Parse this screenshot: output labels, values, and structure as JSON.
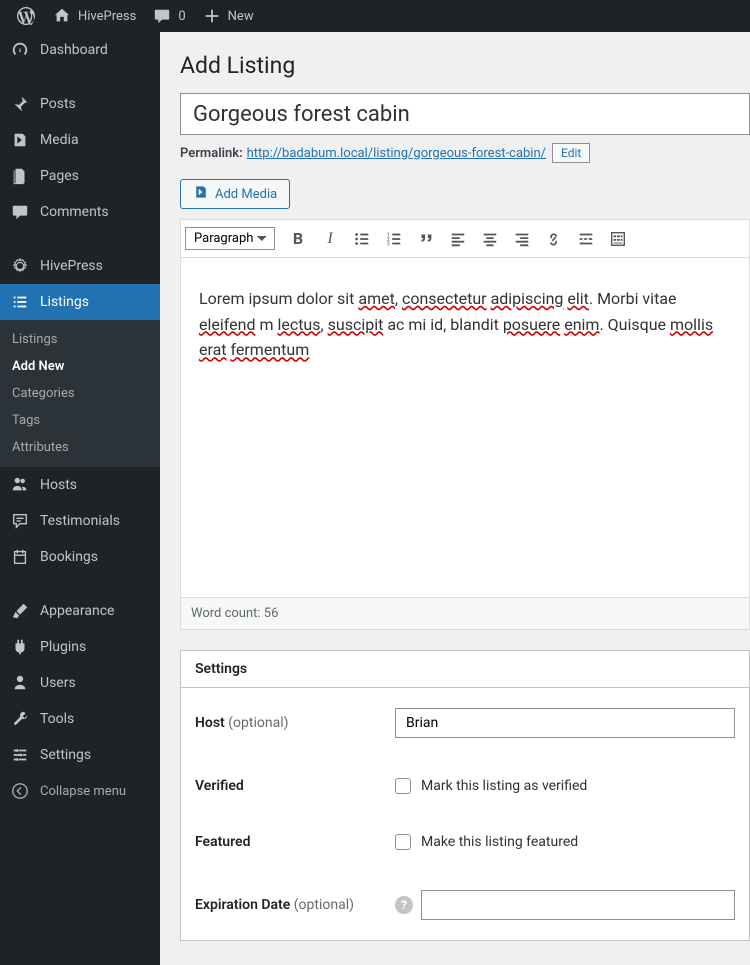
{
  "adminbar": {
    "site_name": "HivePress",
    "comments_count": "0",
    "new_label": "New"
  },
  "sidebar": {
    "dashboard": "Dashboard",
    "posts": "Posts",
    "media": "Media",
    "pages": "Pages",
    "comments": "Comments",
    "hivepress": "HivePress",
    "listings": "Listings",
    "submenu": {
      "listings": "Listings",
      "add_new": "Add New",
      "categories": "Categories",
      "tags": "Tags",
      "attributes": "Attributes"
    },
    "hosts": "Hosts",
    "testimonials": "Testimonials",
    "bookings": "Bookings",
    "appearance": "Appearance",
    "plugins": "Plugins",
    "users": "Users",
    "tools": "Tools",
    "settings": "Settings",
    "collapse": "Collapse menu"
  },
  "page": {
    "title": "Add Listing",
    "listing_title": "Gorgeous forest cabin",
    "permalink_label": "Permalink:",
    "permalink_url": "http://badabum.local/listing/gorgeous-forest-cabin/",
    "edit_label": "Edit",
    "add_media": "Add Media",
    "format_select": "Paragraph",
    "editor_text_1": "Lorem ipsum dolor sit ",
    "editor_sp_1": "amet",
    "editor_text_2": ", ",
    "editor_sp_2": "consectetur",
    "editor_text_3": " ",
    "editor_sp_3": "adipiscing",
    "editor_text_4": " ",
    "editor_sp_4": "elit",
    "editor_text_5": ". Morbi vitae ",
    "editor_sp_5": "eleifend",
    "editor_text_6": " m",
    "editor_sp_6": "lectus",
    "editor_text_7": ", ",
    "editor_sp_7": "suscipit",
    "editor_text_8": " ac mi id, blandit ",
    "editor_sp_8": "posuere",
    "editor_text_9": " ",
    "editor_sp_9": "enim",
    "editor_text_10": ". Quisque ",
    "editor_sp_10": "mollis",
    "editor_text_11": " ",
    "editor_sp_11": "erat",
    "editor_text_12": " ",
    "editor_sp_12": "fermentum",
    "word_count": "Word count: 56",
    "settings_header": "Settings",
    "host_label": "Host",
    "optional": "(optional)",
    "host_value": "Brian",
    "verified_label": "Verified",
    "verified_cb": "Mark this listing as verified",
    "featured_label": "Featured",
    "featured_cb": "Make this listing featured",
    "expiration_label": "Expiration Date"
  }
}
